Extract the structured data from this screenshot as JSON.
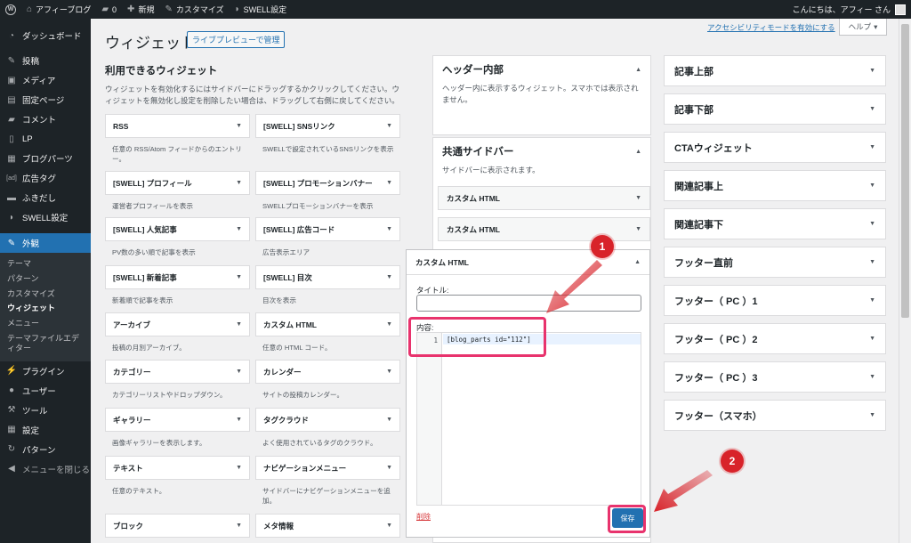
{
  "adminbar": {
    "site_name": "アフィーブログ",
    "comment_count": "0",
    "new_label": "新規",
    "customize_label": "カスタマイズ",
    "swell_label": "SWELL設定",
    "greeting": "こんにちは、アフィー さん"
  },
  "menu": {
    "dashboard": "ダッシュボード",
    "posts": "投稿",
    "media": "メディア",
    "pages": "固定ページ",
    "comments": "コメント",
    "lp": "LP",
    "blog_parts": "ブログパーツ",
    "ad_tag": "広告タグ",
    "fukidashi": "ふきだし",
    "swell_settings": "SWELL設定",
    "appearance": "外観",
    "sub": {
      "themes": "テーマ",
      "patterns": "パターン",
      "customize": "カスタマイズ",
      "widgets": "ウィジェット",
      "menus": "メニュー",
      "theme_editor": "テーマファイルエディター"
    },
    "plugins": "プラグイン",
    "users": "ユーザー",
    "tools": "ツール",
    "settings": "設定",
    "patterns": "パターン",
    "collapse": "メニューを閉じる"
  },
  "page": {
    "title": "ウィジェット",
    "live_preview": "ライブプレビューで管理",
    "a11y_link": "アクセシビリティモードを有効にする",
    "help": "ヘルプ"
  },
  "available": {
    "title": "利用できるウィジェット",
    "desc": "ウィジェットを有効化するにはサイドバーにドラッグするかクリックしてください。ウィジェットを無効化し設定を削除したい場合は、ドラッグして右側に戻してください。",
    "widgets": [
      {
        "name": "RSS",
        "desc": "任意の RSS/Atom フィードからのエントリー。"
      },
      {
        "name": "[SWELL] SNSリンク",
        "desc": "SWELLで設定されているSNSリンクを表示"
      },
      {
        "name": "[SWELL] プロフィール",
        "desc": "運営者プロフィールを表示"
      },
      {
        "name": "[SWELL] プロモーションバナー",
        "desc": "SWELLプロモーションバナーを表示"
      },
      {
        "name": "[SWELL] 人気記事",
        "desc": "PV数の多い順で記事を表示"
      },
      {
        "name": "[SWELL] 広告コード",
        "desc": "広告表示エリア"
      },
      {
        "name": "[SWELL] 新着記事",
        "desc": "新着順で記事を表示"
      },
      {
        "name": "[SWELL] 目次",
        "desc": "目次を表示"
      },
      {
        "name": "アーカイブ",
        "desc": "投稿の月別アーカイブ。"
      },
      {
        "name": "カスタム HTML",
        "desc": "任意の HTML コード。"
      },
      {
        "name": "カテゴリー",
        "desc": "カテゴリーリストやドロップダウン。"
      },
      {
        "name": "カレンダー",
        "desc": "サイトの投稿カレンダー。"
      },
      {
        "name": "ギャラリー",
        "desc": "画像ギャラリーを表示します。"
      },
      {
        "name": "タグクラウド",
        "desc": "よく使用されているタグのクラウド。"
      },
      {
        "name": "テキスト",
        "desc": "任意のテキスト。"
      },
      {
        "name": "ナビゲーションメニュー",
        "desc": "サイドバーにナビゲーションメニューを追加。"
      },
      {
        "name": "ブロック",
        "desc": ""
      },
      {
        "name": "メタ情報",
        "desc": ""
      }
    ]
  },
  "header_area": {
    "title": "ヘッダー内部",
    "desc": "ヘッダー内に表示するウィジェット。スマホでは表示されません。"
  },
  "sidebar_area": {
    "title": "共通サイドバー",
    "desc": "サイドバーに表示されます。",
    "widgets": [
      "カスタム HTML",
      "カスタム HTML"
    ]
  },
  "open_widget": {
    "title": "カスタム HTML",
    "title_label": "タイトル:",
    "title_value": "",
    "content_label": "内容:",
    "line_number": "1",
    "code": "[blog_parts id=\"112\"]",
    "delete": "削除",
    "save": "保存"
  },
  "right_areas": [
    "記事上部",
    "記事下部",
    "CTAウィジェット",
    "関連記事上",
    "関連記事下",
    "フッター直前",
    "フッター（ PC ）1",
    "フッター（ PC ）2",
    "フッター（ PC ）3",
    "フッター（スマホ）"
  ],
  "annotations": {
    "step1": "1",
    "step2": "2"
  },
  "colors": {
    "adminbar": "#1d2327",
    "accent": "#2271b1",
    "highlight": "#e8336d",
    "badge": "#d8232a"
  }
}
